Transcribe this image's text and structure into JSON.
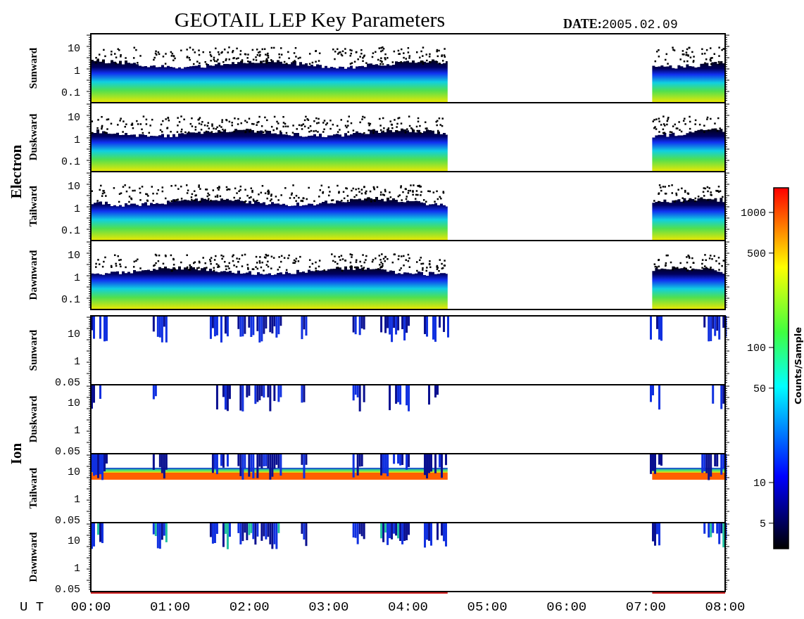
{
  "title": "GEOTAIL LEP Key Parameters",
  "date": {
    "label": "DATE:",
    "value": "2005.02.09"
  },
  "species": [
    {
      "name": "Electron",
      "kind": "electron",
      "panels": [
        {
          "direction": "Sunward",
          "ticks": [
            "10",
            "1",
            "0.1"
          ]
        },
        {
          "direction": "Duskward",
          "ticks": [
            "10",
            "1",
            "0.1"
          ]
        },
        {
          "direction": "Tailward",
          "ticks": [
            "10",
            "1",
            "0.1"
          ]
        },
        {
          "direction": "Dawnward",
          "ticks": [
            "10",
            "1",
            "0.1"
          ]
        }
      ]
    },
    {
      "name": "Ion",
      "kind": "ion",
      "panels": [
        {
          "direction": "Sunward",
          "ticks": [
            "10",
            "1",
            "0.05"
          ]
        },
        {
          "direction": "Duskward",
          "ticks": [
            "10",
            "1",
            "0.05"
          ]
        },
        {
          "direction": "Tailward",
          "ticks": [
            "10",
            "1",
            "0.05"
          ]
        },
        {
          "direction": "Dawnward",
          "ticks": [
            "10",
            "1",
            "0.05"
          ]
        }
      ]
    }
  ],
  "time_axis": {
    "label": "U T",
    "ticks": [
      "00:00",
      "01:00",
      "02:00",
      "03:00",
      "04:00",
      "05:00",
      "06:00",
      "07:00",
      "08:00"
    ]
  },
  "colorbar": {
    "title": "Counts/Sample",
    "ticks": [
      "1000",
      "500",
      "100",
      "50",
      "10",
      "5"
    ]
  }
}
